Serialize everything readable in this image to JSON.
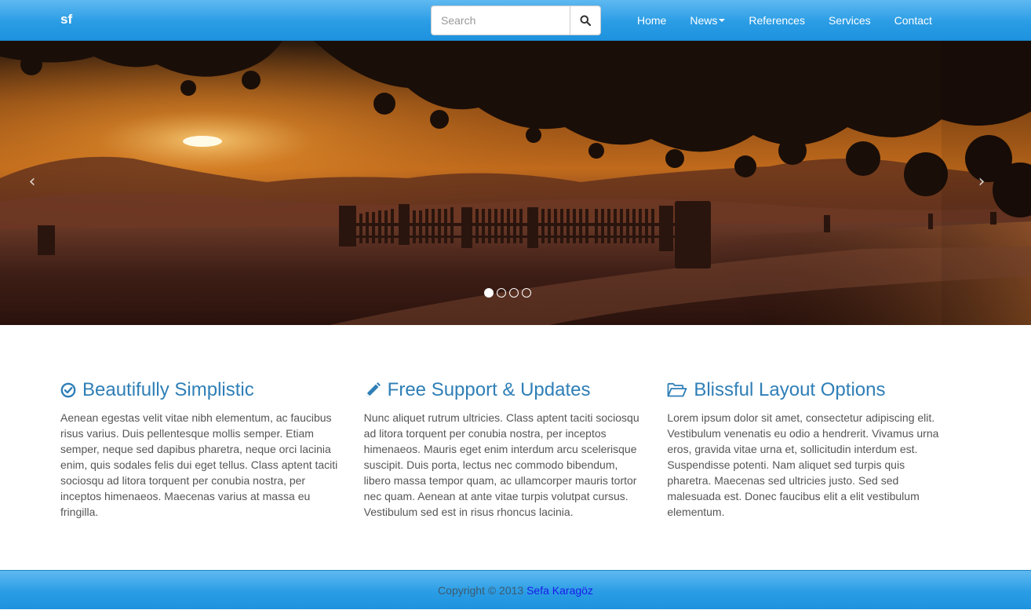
{
  "navbar": {
    "brand": "sf",
    "search": {
      "placeholder": "Search",
      "value": ""
    },
    "items": [
      {
        "label": "Home"
      },
      {
        "label": "News",
        "dropdown": true
      },
      {
        "label": "References"
      },
      {
        "label": "Services"
      },
      {
        "label": "Contact"
      }
    ],
    "icons": {
      "search": "search-icon",
      "dropdown": "caret-down-icon"
    }
  },
  "carousel": {
    "prev_label": "‹",
    "next_label": "›",
    "slide_count": 4,
    "active_index": 0
  },
  "features": [
    {
      "icon": "check-circle-icon",
      "title": "Beautifully Simplistic",
      "text": "Aenean egestas velit vitae nibh elementum, ac faucibus risus varius. Duis pellentesque mollis semper. Etiam semper, neque sed dapibus pharetra, neque orci lacinia enim, quis sodales felis dui eget tellus. Class aptent taciti sociosqu ad litora torquent per conubia nostra, per inceptos himenaeos. Maecenas varius at massa eu fringilla."
    },
    {
      "icon": "pencil-icon",
      "title": "Free Support & Updates",
      "text": "Nunc aliquet rutrum ultricies. Class aptent taciti sociosqu ad litora torquent per conubia nostra, per inceptos himenaeos. Mauris eget enim interdum arcu scelerisque suscipit. Duis porta, lectus nec commodo bibendum, libero massa tempor quam, ac ullamcorper mauris tortor nec quam. Aenean at ante vitae turpis volutpat cursus. Vestibulum sed est in risus rhoncus lacinia."
    },
    {
      "icon": "folder-open-icon",
      "title": "Blissful Layout Options",
      "text": "Lorem ipsum dolor sit amet, consectetur adipiscing elit. Vestibulum venenatis eu odio a hendrerit. Vivamus urna eros, gravida vitae urna et, sollicitudin interdum est. Suspendisse potenti. Nam aliquet sed turpis quis pharetra. Maecenas sed ultricies justo. Sed sed malesuada est. Donec faucibus elit a elit vestibulum elementum."
    }
  ],
  "footer": {
    "copyright": "Copyright © 2013 ",
    "author": "Sefa Karagöz"
  },
  "colors": {
    "nav_gradient_top": "#5fb9f1",
    "nav_gradient_bottom": "#1e92de",
    "heading": "#2f7fb7",
    "body_text": "#555555",
    "footer_link": "#1a1ae8"
  }
}
